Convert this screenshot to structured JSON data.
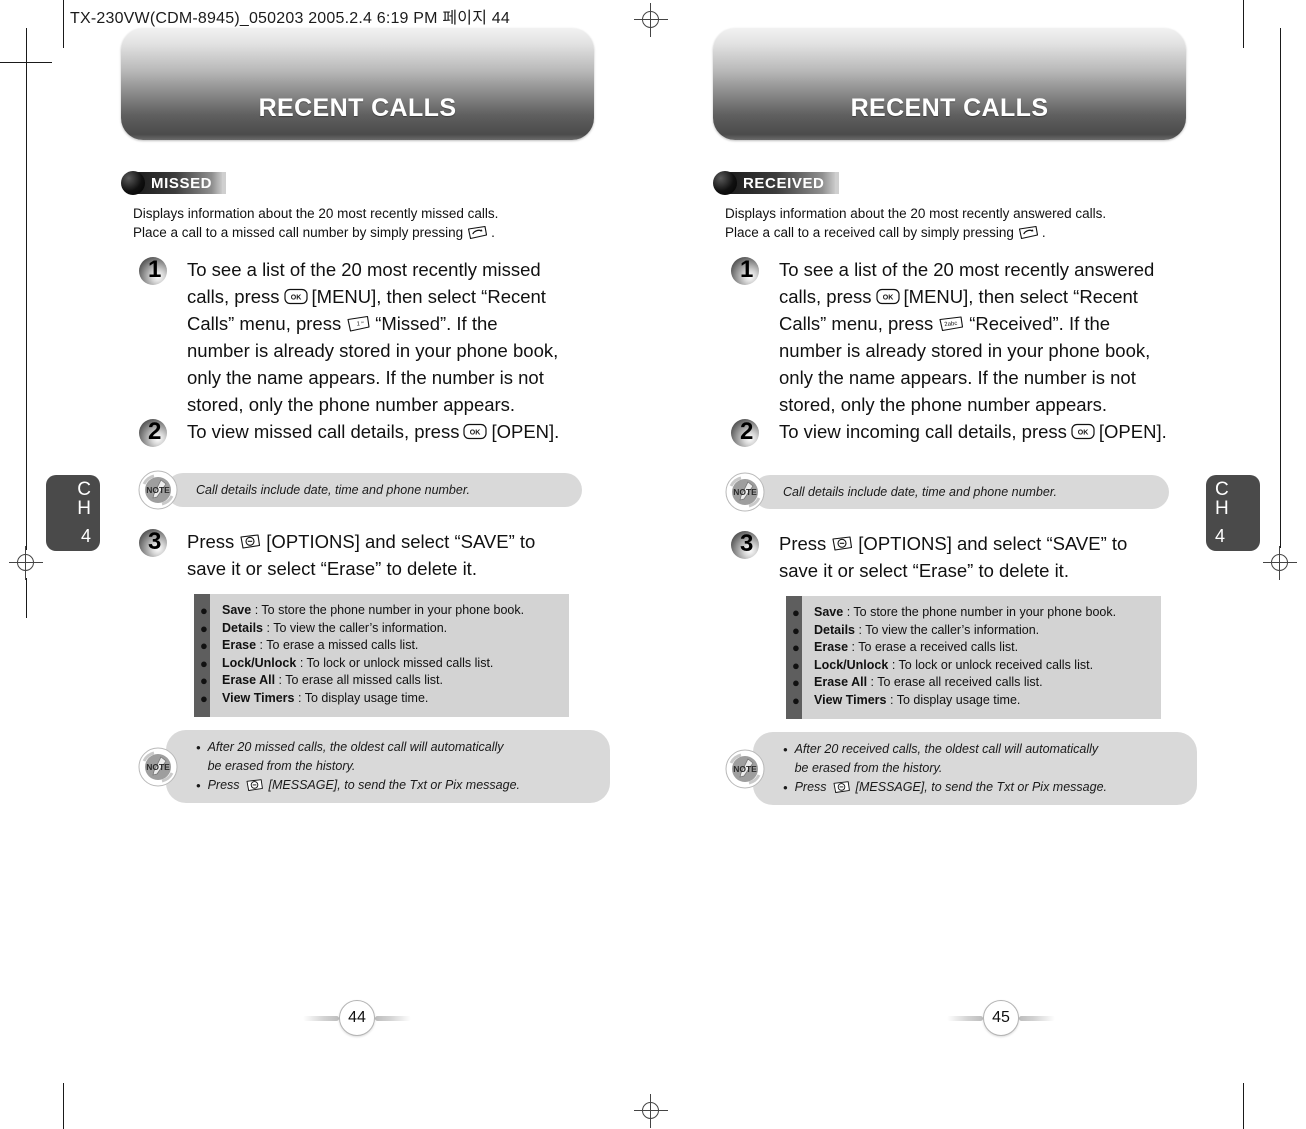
{
  "file_meta": "TX-230VW(CDM-8945)_050203  2005.2.4 6:19 PM 페이지 44",
  "pages": [
    {
      "banner_title": "RECENT CALLS",
      "section_label": "MISSED",
      "chapter_label": "CH",
      "chapter_number": "4",
      "page_number": "44",
      "intro": [
        "Displays information about the 20 most recently missed calls.",
        "Place a call to a missed call number by simply pressing"
      ],
      "intro_key": "send-key",
      "intro_tail": ".",
      "steps": [
        {
          "number": "1",
          "lines": [
            [
              {
                "t": "text",
                "v": "To see a list of the 20 most recently missed"
              }
            ],
            [
              {
                "t": "text",
                "v": "calls, press"
              },
              {
                "t": "key",
                "v": "ok-key"
              },
              {
                "t": "text",
                "v": "[MENU], then select “Recent"
              }
            ],
            [
              {
                "t": "text",
                "v": "Calls” menu, press"
              },
              {
                "t": "key",
                "v": "key-1"
              },
              {
                "t": "text",
                "v": "“Missed”. If the"
              }
            ],
            [
              {
                "t": "text",
                "v": "number is already stored in your phone book,"
              }
            ],
            [
              {
                "t": "text",
                "v": "only the name appears. If the number is not"
              }
            ],
            [
              {
                "t": "text",
                "v": "stored, only the phone number appears."
              }
            ]
          ]
        },
        {
          "number": "2",
          "lines": [
            [
              {
                "t": "text",
                "v": "To view missed call details, press"
              },
              {
                "t": "key",
                "v": "ok-key"
              },
              {
                "t": "text",
                "v": "[OPEN]."
              }
            ]
          ]
        },
        {
          "number": "3",
          "lines": [
            [
              {
                "t": "text",
                "v": "Press"
              },
              {
                "t": "key",
                "v": "options-key"
              },
              {
                "t": "text",
                "v": "[OPTIONS] and select “SAVE” to"
              }
            ],
            [
              {
                "t": "text",
                "v": "save it or select “Erase” to delete it."
              }
            ]
          ]
        }
      ],
      "note_one": "Call details include date, time and phone number.",
      "options": [
        {
          "name": "Save",
          "desc": ": To store the phone number in your phone book."
        },
        {
          "name": "Details",
          "desc": ": To view the caller’s information."
        },
        {
          "name": "Erase",
          "desc": ": To erase a missed calls list."
        },
        {
          "name": "Lock/Unlock",
          "desc": ": To lock or unlock missed calls list."
        },
        {
          "name": "Erase All",
          "desc": ": To erase all missed calls list."
        },
        {
          "name": "View Timers",
          "desc": ": To display usage time."
        }
      ],
      "note_two": [
        {
          "lines": [
            [
              {
                "t": "text",
                "v": "After 20 missed calls, the oldest call will automatically"
              }
            ],
            [
              {
                "t": "text",
                "v": "be erased from the history."
              }
            ]
          ]
        },
        {
          "lines": [
            [
              {
                "t": "text",
                "v": "Press"
              },
              {
                "t": "key",
                "v": "options-key"
              },
              {
                "t": "text",
                "v": "[MESSAGE], to send the Txt or Pix message."
              }
            ]
          ]
        }
      ]
    },
    {
      "banner_title": "RECENT CALLS",
      "section_label": "RECEIVED",
      "chapter_label": "CH",
      "chapter_number": "4",
      "page_number": "45",
      "intro": [
        "Displays information about the 20 most recently answered calls.",
        "Place a call to a received call by simply pressing"
      ],
      "intro_key": "send-key",
      "intro_tail": ".",
      "steps": [
        {
          "number": "1",
          "lines": [
            [
              {
                "t": "text",
                "v": "To see a list of the 20 most recently answered"
              }
            ],
            [
              {
                "t": "text",
                "v": "calls, press"
              },
              {
                "t": "key",
                "v": "ok-key"
              },
              {
                "t": "text",
                "v": "[MENU], then select “Recent"
              }
            ],
            [
              {
                "t": "text",
                "v": "Calls” menu, press"
              },
              {
                "t": "key",
                "v": "key-2abc"
              },
              {
                "t": "text",
                "v": "“Received”. If the"
              }
            ],
            [
              {
                "t": "text",
                "v": "number is already stored in your phone book,"
              }
            ],
            [
              {
                "t": "text",
                "v": "only the name appears. If the number is not"
              }
            ],
            [
              {
                "t": "text",
                "v": "stored, only the phone number appears."
              }
            ]
          ]
        },
        {
          "number": "2",
          "lines": [
            [
              {
                "t": "text",
                "v": "To view incoming call details, press"
              },
              {
                "t": "key",
                "v": "ok-key"
              },
              {
                "t": "text",
                "v": "[OPEN]."
              }
            ]
          ]
        },
        {
          "number": "3",
          "lines": [
            [
              {
                "t": "text",
                "v": "Press"
              },
              {
                "t": "key",
                "v": "options-key"
              },
              {
                "t": "text",
                "v": "[OPTIONS] and select “SAVE” to"
              }
            ],
            [
              {
                "t": "text",
                "v": "save it or select “Erase” to delete it."
              }
            ]
          ]
        }
      ],
      "note_one": "Call details include date, time and phone number.",
      "options": [
        {
          "name": "Save",
          "desc": ": To store the phone number in your phone book."
        },
        {
          "name": "Details",
          "desc": ": To view the caller’s information."
        },
        {
          "name": "Erase",
          "desc": ": To erase a received calls list."
        },
        {
          "name": "Lock/Unlock",
          "desc": ": To lock or unlock received calls list."
        },
        {
          "name": "Erase All",
          "desc": ": To erase all received calls list."
        },
        {
          "name": "View Timers",
          "desc": ": To display usage time."
        }
      ],
      "note_two": [
        {
          "lines": [
            [
              {
                "t": "text",
                "v": "After 20 received calls, the oldest call will automatically"
              }
            ],
            [
              {
                "t": "text",
                "v": "be erased from the history."
              }
            ]
          ]
        },
        {
          "lines": [
            [
              {
                "t": "text",
                "v": "Press"
              },
              {
                "t": "key",
                "v": "options-key"
              },
              {
                "t": "text",
                "v": "[MESSAGE], to send the Txt or Pix message."
              }
            ]
          ]
        }
      ]
    }
  ],
  "note_icon_text": "NOTE",
  "bullet_glyph": "●",
  "note_bullet_glyph": "•",
  "colors": {
    "banner_dark": "#4b4b4b",
    "note_bg": "#d9d9d9",
    "option_box_bg": "#d3d3d3",
    "option_bar": "#5e5e5e",
    "chapter_tab": "#4a4a4a"
  }
}
